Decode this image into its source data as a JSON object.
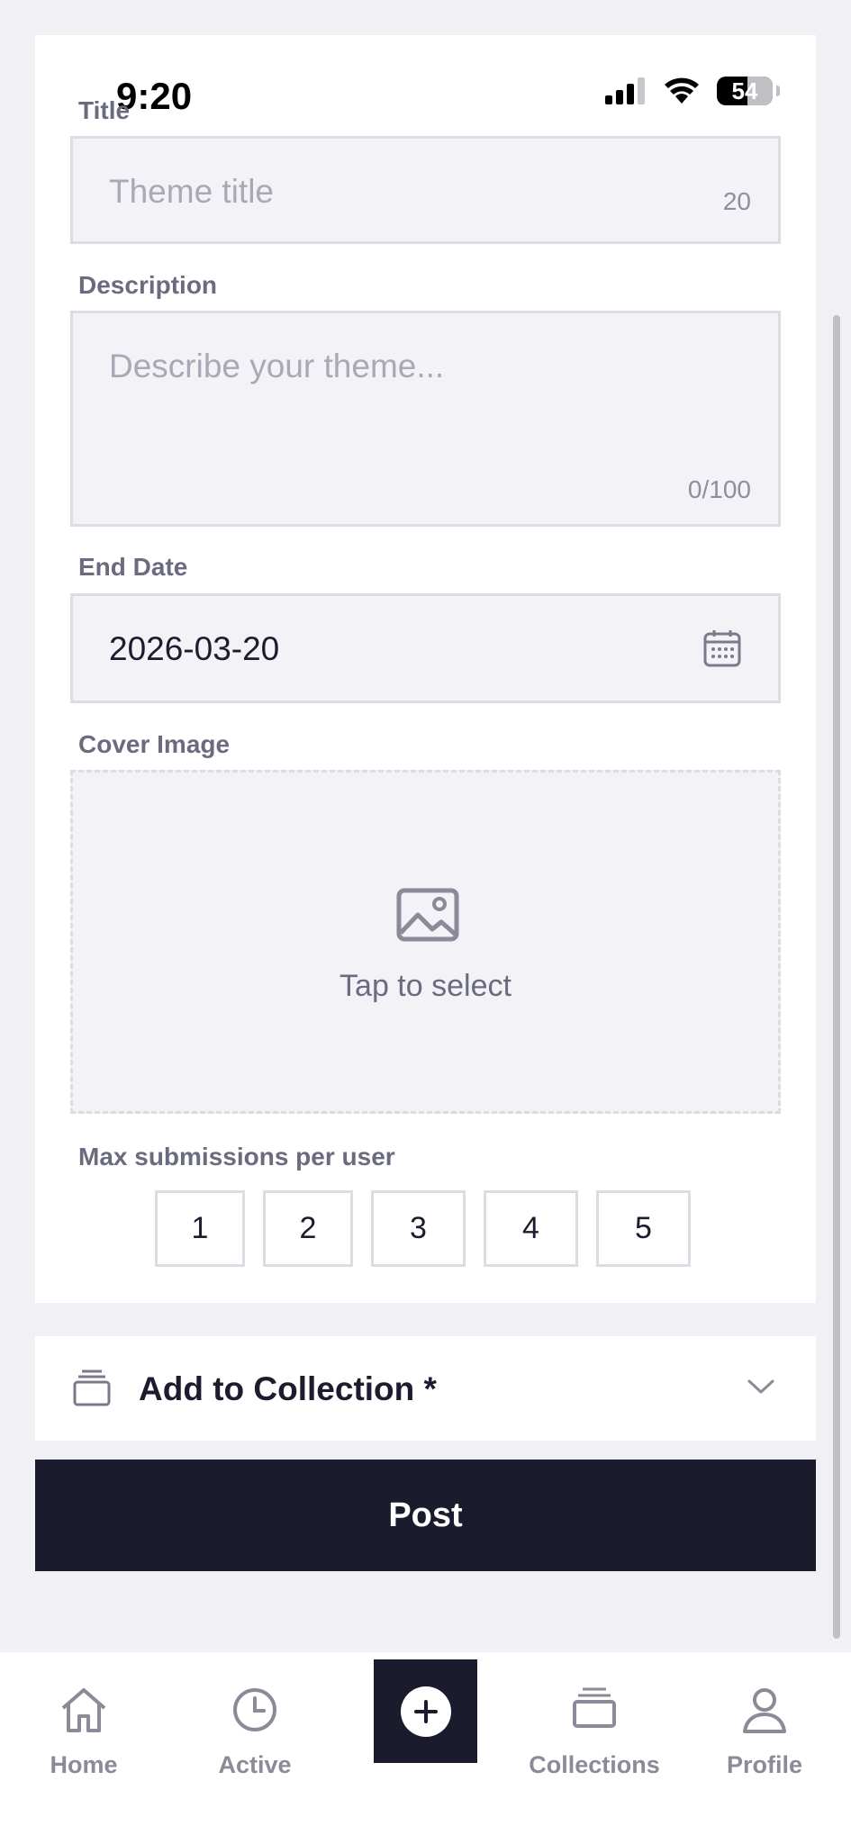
{
  "status": {
    "time": "9:20",
    "battery": "54"
  },
  "form": {
    "title_label": "Title",
    "title_placeholder": "Theme title",
    "title_counter": "20",
    "description_label": "Description",
    "description_placeholder": "Describe your theme...",
    "description_counter": "0/100",
    "end_date_label": "End Date",
    "end_date_value": "2026-03-20",
    "cover_label": "Cover Image",
    "cover_hint": "Tap to select",
    "max_label": "Max submissions per user",
    "max_options": [
      "1",
      "2",
      "3",
      "4",
      "5"
    ]
  },
  "collection": {
    "label": "Add to Collection *"
  },
  "post_label": "Post",
  "tabs": {
    "home": "Home",
    "active": "Active",
    "collections": "Collections",
    "profile": "Profile"
  },
  "colors": {
    "primary": "#1b1b2e",
    "field_bg": "#f2f2f7",
    "border": "#dcdce3",
    "muted": "#8a8a98"
  }
}
